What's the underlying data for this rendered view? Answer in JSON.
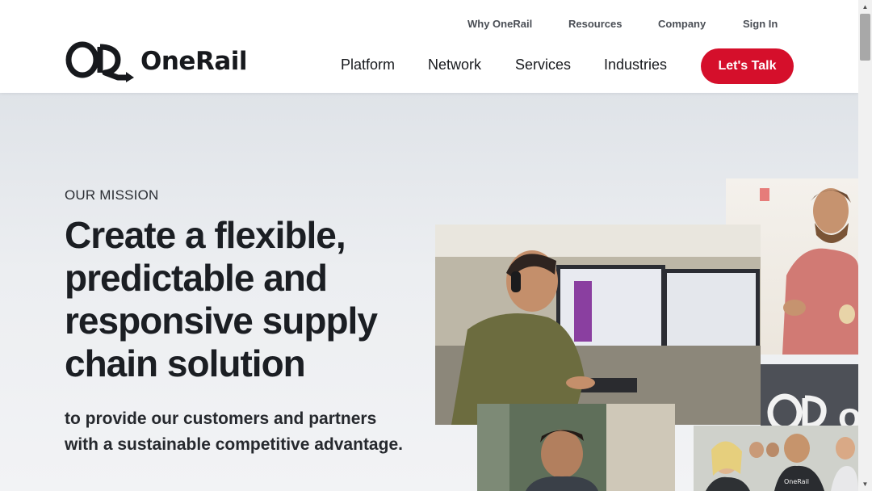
{
  "brand": {
    "name": "OneRail",
    "accent": "#d50f2b"
  },
  "util_nav": [
    {
      "label": "Why OneRail"
    },
    {
      "label": "Resources"
    },
    {
      "label": "Company"
    },
    {
      "label": "Sign In"
    }
  ],
  "main_nav": [
    {
      "label": "Platform"
    },
    {
      "label": "Network"
    },
    {
      "label": "Services"
    },
    {
      "label": "Industries"
    }
  ],
  "cta": {
    "label": "Let's Talk"
  },
  "hero": {
    "eyebrow": "OUR MISSION",
    "headline": "Create a flexible, predictable and responsive supply chain solution",
    "subline": "to provide our customers and partners with a sustainable competitive advantage.",
    "photo_logo_text": "OneRail"
  }
}
